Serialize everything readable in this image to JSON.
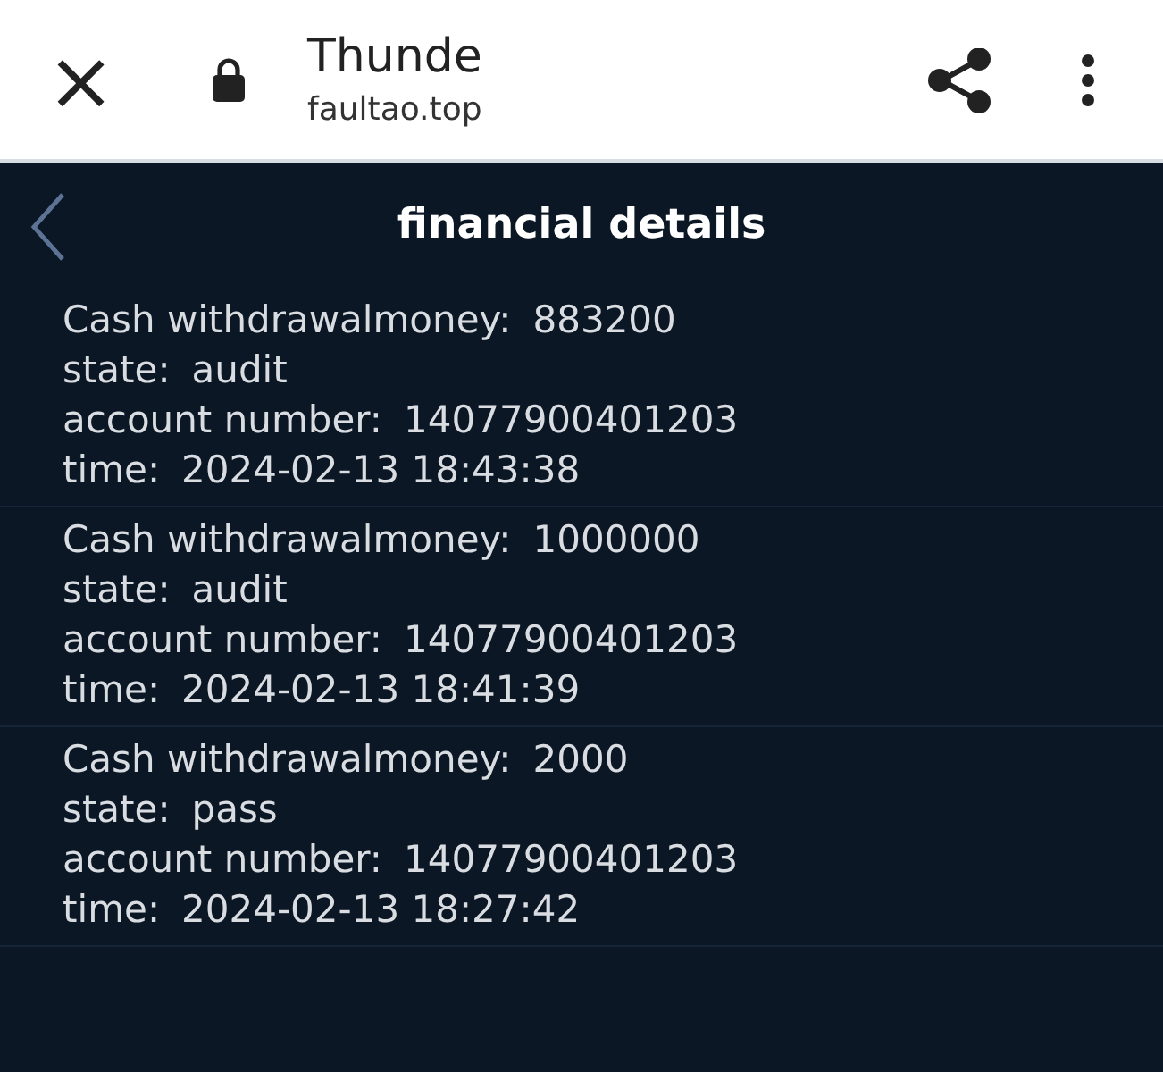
{
  "browser_bar": {
    "close": "×",
    "title": "Thunde",
    "url": "faultao.top"
  },
  "header": {
    "title": "financial details"
  },
  "records": [
    {
      "lines": [
        {
          "label": "Cash withdrawalmoney:",
          "value": "883200"
        },
        {
          "label": "state:",
          "value": "audit"
        },
        {
          "label": "account number:",
          "value": "14077900401203"
        },
        {
          "label": "time:",
          "value": "2024-02-13 18:43:38"
        }
      ]
    },
    {
      "lines": [
        {
          "label": "Cash withdrawalmoney:",
          "value": "1000000"
        },
        {
          "label": "state:",
          "value": "audit"
        },
        {
          "label": "account number:",
          "value": "14077900401203"
        },
        {
          "label": "time:",
          "value": "2024-02-13 18:41:39"
        }
      ]
    },
    {
      "lines": [
        {
          "label": "Cash withdrawalmoney:",
          "value": "2000"
        },
        {
          "label": "state:",
          "value": "pass"
        },
        {
          "label": "account number:",
          "value": "14077900401203"
        },
        {
          "label": "time:",
          "value": "2024-02-13 18:27:42"
        }
      ]
    }
  ]
}
